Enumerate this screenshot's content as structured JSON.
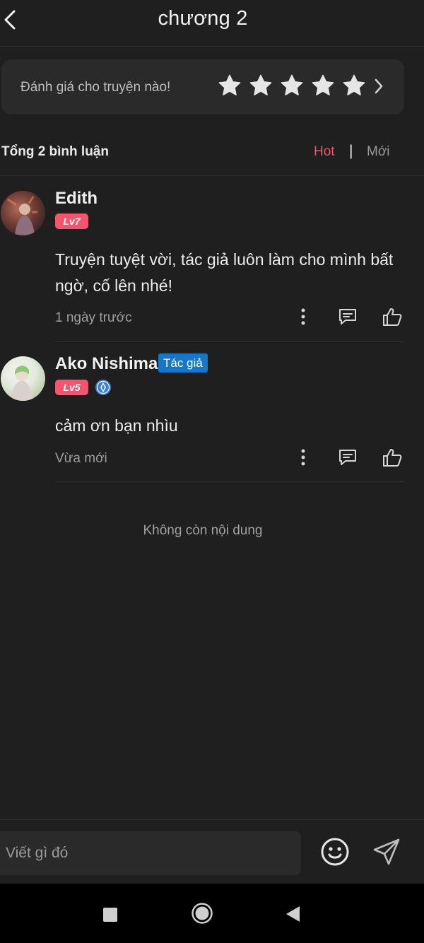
{
  "header": {
    "title": "chương 2",
    "back_icon": "chevron-left-icon"
  },
  "rating": {
    "prompt": "Đánh giá cho truyện nào!",
    "star_count": 5,
    "star_color": "#e6e6e6",
    "chevron_icon": "chevron-right-icon"
  },
  "comments_summary": {
    "total_label": "Tổng 2 bình luận",
    "sort_hot": "Hot",
    "sort_separator": "|",
    "sort_new": "Mới",
    "active_sort_color": "#e8566b"
  },
  "comments": [
    {
      "username": "Edith",
      "level": "Lv7",
      "text": "Truyện tuyệt vời, tác giả luôn làm cho mình bất ngờ, cố lên nhé!",
      "time": "1 ngày trước"
    },
    {
      "username": "Ako Nishima",
      "author_tag": "Tác giả",
      "level": "Lv5",
      "verified_icon": "diamond-badge-icon",
      "text": "cảm ơn bạn nhìu",
      "time": "Vừa mới"
    }
  ],
  "end_message": "Không còn nội dung",
  "composer": {
    "placeholder": "Viết gì đó",
    "emoji_icon": "smiley-icon",
    "send_icon": "send-icon"
  },
  "colors": {
    "background": "#1f1f1f",
    "card": "#2a2a2a",
    "level_badge": "#f1566e",
    "author_tag": "#1677c8"
  }
}
